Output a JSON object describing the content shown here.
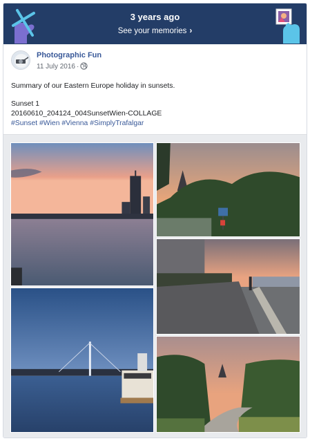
{
  "memory": {
    "title": "3 years ago",
    "link_label": "See your memories",
    "link_icon": "chevron-right-icon"
  },
  "post": {
    "page_name": "Photographic Fun",
    "date": "11 July 2016",
    "privacy_icon": "globe-icon",
    "summary": "Summary of our Eastern Europe holiday in sunsets.",
    "photo_title": "Sunset 1",
    "filename": "20160610_204124_004SunsetWien-COLLAGE",
    "hashtags": [
      "#Sunset",
      "#Wien",
      "#Vienna",
      "#SimplyTrafalgar"
    ]
  },
  "colors": {
    "banner": "#233d67",
    "link": "#385898",
    "text": "#1c1e21",
    "meta": "#616770"
  },
  "photos": [
    {
      "name": "photo-danube-skyline-sunset"
    },
    {
      "name": "photo-church-trees-sunset"
    },
    {
      "name": "photo-riverside-promenade"
    },
    {
      "name": "photo-bridge-boat-dusk"
    },
    {
      "name": "photo-path-trees-sunset"
    }
  ]
}
